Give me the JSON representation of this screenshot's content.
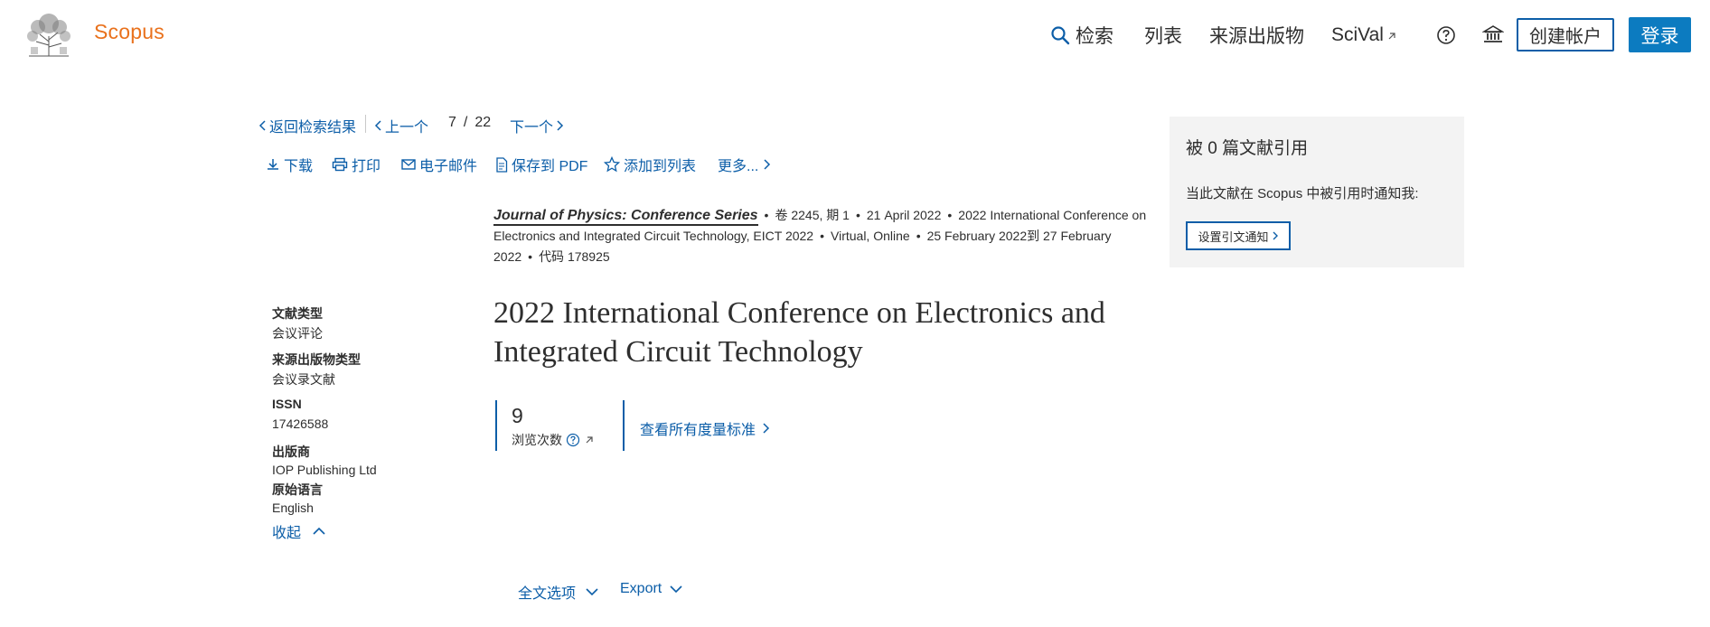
{
  "header": {
    "brand": "Scopus",
    "nav": {
      "search": "检索",
      "lists": "列表",
      "sources": "来源出版物",
      "scival": "SciVal"
    },
    "create_account": "创建帐户",
    "login": "登录"
  },
  "navrow": {
    "back": "返回检索结果",
    "prev": "上一个",
    "current": "7",
    "slash": "/",
    "total": "22",
    "next": "下一个"
  },
  "actions": {
    "download": "下载",
    "print": "打印",
    "email": "电子邮件",
    "save_pdf": "保存到 PDF",
    "add_list": "添加到列表",
    "more": "更多..."
  },
  "source": {
    "journal": "Journal of Physics: Conference Series",
    "volume": "卷 2245, 期 1",
    "date": "21 April 2022",
    "conference": "2022 International Conference on Electronics and Integrated Circuit Technology, EICT 2022",
    "location": "Virtual, Online",
    "dates": "25 February 2022到 27 February 2022",
    "code": "代码 178925"
  },
  "title": "2022 International Conference on Electronics and Integrated Circuit Technology",
  "meta": {
    "doc_type_label": "文献类型",
    "doc_type_value": "会议评论",
    "source_type_label": "来源出版物类型",
    "source_type_value": "会议录文献",
    "issn_label": "ISSN",
    "issn_value": "17426588",
    "publisher_label": "出版商",
    "publisher_value": "IOP Publishing Ltd",
    "language_label": "原始语言",
    "language_value": "English",
    "collapse": "收起"
  },
  "metrics": {
    "views_count": "9",
    "views_label": "浏览次数",
    "view_all": "查看所有度量标准"
  },
  "citation_panel": {
    "title": "被 0 篇文献引用",
    "text": "当此文献在 Scopus 中被引用时通知我:",
    "button": "设置引文通知"
  },
  "bottom": {
    "fulltext": "全文选项",
    "export": "Export"
  },
  "colors": {
    "link": "#0c5ea8",
    "brand": "#e9711c",
    "primary_button": "#0c7bc0",
    "panel_bg": "#f3f3f3"
  }
}
